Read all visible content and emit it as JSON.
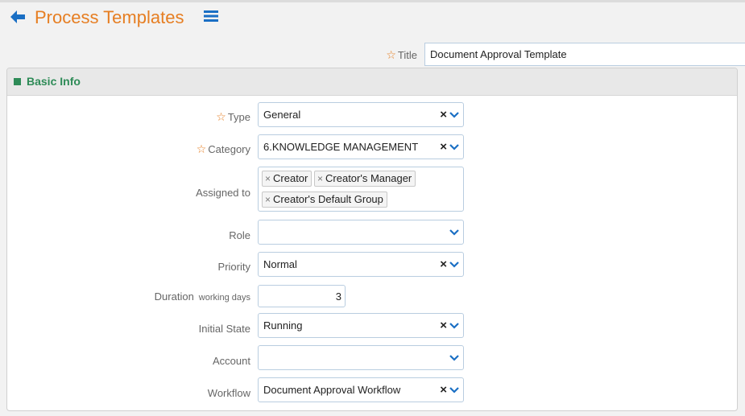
{
  "header": {
    "title": "Process Templates",
    "back_icon": "arrow-left-icon",
    "menu_icon": "hamburger-menu-icon",
    "accent_color": "#e67e22",
    "icon_color": "#1a6fc4"
  },
  "title_field": {
    "label": "Title",
    "value": "Document Approval Template"
  },
  "panel": {
    "title": "Basic Info",
    "color": "#2e8b57"
  },
  "form": {
    "type": {
      "label": "Type",
      "value": "General"
    },
    "category": {
      "label": "Category",
      "value": "6.KNOWLEDGE MANAGEMENT"
    },
    "assigned_to": {
      "label": "Assigned to",
      "tags": [
        "Creator",
        "Creator's Manager",
        "Creator's Default Group"
      ]
    },
    "role": {
      "label": "Role",
      "value": ""
    },
    "priority": {
      "label": "Priority",
      "value": "Normal"
    },
    "duration": {
      "label": "Duration",
      "unit": "working days",
      "value": "3"
    },
    "initial_state": {
      "label": "Initial State",
      "value": "Running"
    },
    "account": {
      "label": "Account",
      "value": ""
    },
    "workflow": {
      "label": "Workflow",
      "value": "Document Approval Workflow"
    }
  }
}
